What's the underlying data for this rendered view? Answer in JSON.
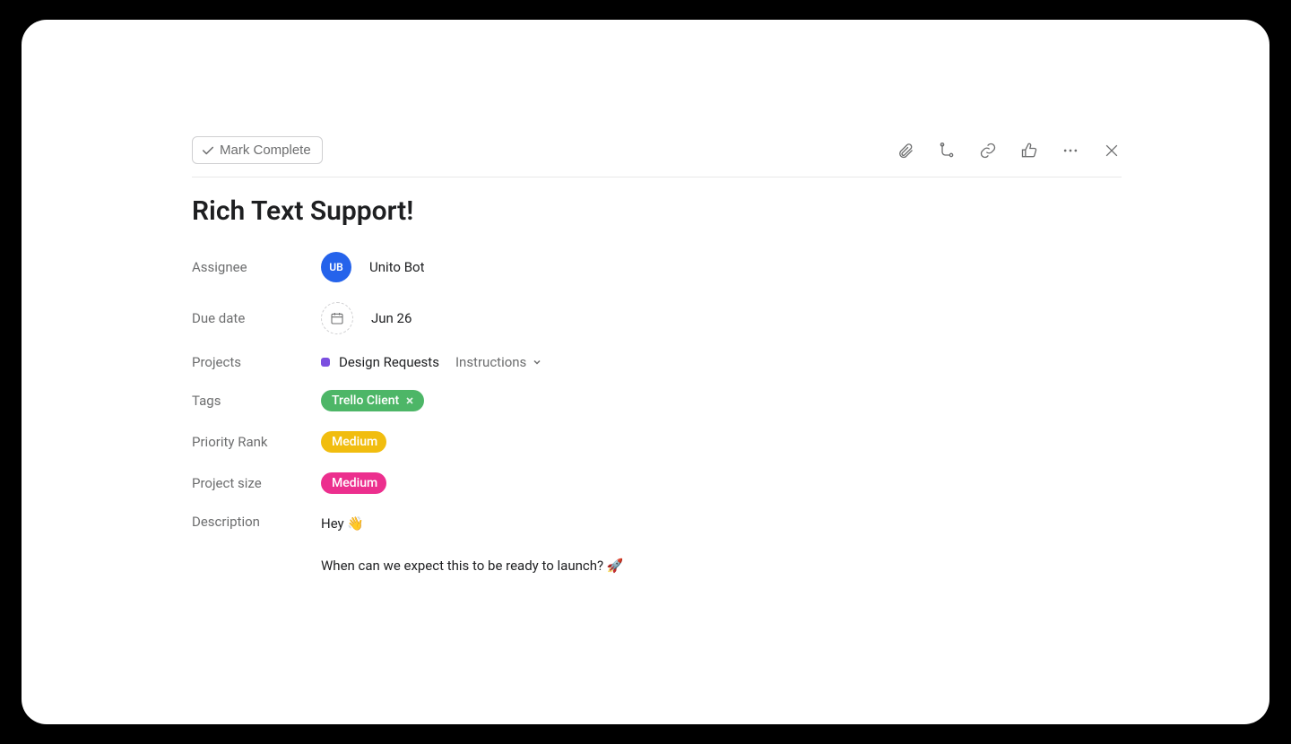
{
  "toolbar": {
    "mark_complete_label": "Mark Complete"
  },
  "task": {
    "title": "Rich Text Support!"
  },
  "fields": {
    "assignee": {
      "label": "Assignee",
      "initials": "UB",
      "name": "Unito Bot"
    },
    "due_date": {
      "label": "Due date",
      "value": "Jun 26"
    },
    "projects": {
      "label": "Projects",
      "project_name": "Design Requests",
      "section": "Instructions",
      "dot_color": "#7b4fe0"
    },
    "tags": {
      "label": "Tags",
      "items": [
        {
          "name": "Trello Client",
          "color": "green"
        }
      ]
    },
    "priority": {
      "label": "Priority Rank",
      "value": "Medium",
      "color": "yellow"
    },
    "project_size": {
      "label": "Project size",
      "value": "Medium",
      "color": "pink"
    },
    "description": {
      "label": "Description",
      "lines": [
        "Hey 👋",
        "When can we expect this to be ready to launch? 🚀"
      ]
    }
  }
}
